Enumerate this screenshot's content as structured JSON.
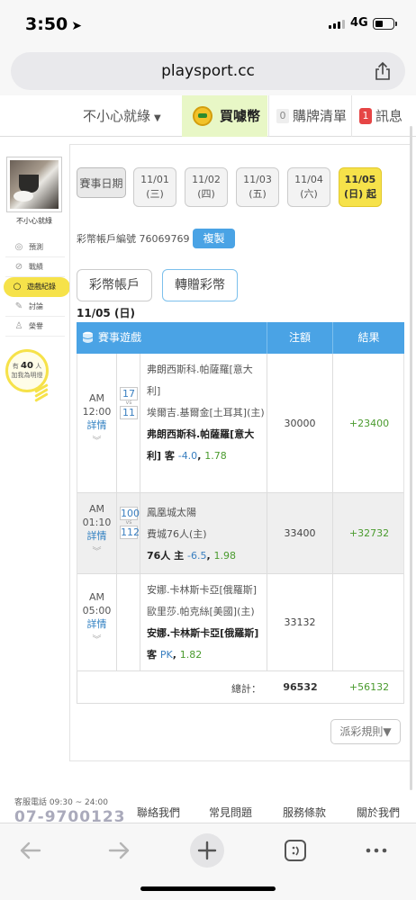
{
  "status": {
    "time": "3:50",
    "network": "4G"
  },
  "browser": {
    "url": "playsport.cc"
  },
  "topnav": {
    "user": "不小心就綠",
    "buy_label": "買噱幣",
    "cart_count": "0",
    "cart_label": "購牌清單",
    "msg_count": "1",
    "msg_label": "訊息"
  },
  "sidebar": {
    "name": "不小心就綠",
    "items": [
      {
        "label": "預測",
        "icon": "target-icon"
      },
      {
        "label": "戰績",
        "icon": "chart-icon"
      },
      {
        "label": "遊戲紀錄",
        "icon": "record-icon"
      },
      {
        "label": "討論",
        "icon": "discussion-icon"
      },
      {
        "label": "榮譽",
        "icon": "honor-icon"
      }
    ],
    "fans_prefix": "有",
    "fans_count": "40",
    "fans_unit": "人",
    "fans_suffix": "加我為明燈"
  },
  "dates": {
    "label": "賽事日期",
    "items": [
      {
        "date": "11/01",
        "day": "(三)"
      },
      {
        "date": "11/02",
        "day": "(四)"
      },
      {
        "date": "11/03",
        "day": "(五)"
      },
      {
        "date": "11/04",
        "day": "(六)"
      },
      {
        "date": "11/05",
        "day": "(日) 起"
      }
    ]
  },
  "account": {
    "label": "彩幣帳戶編號",
    "number": "76069769",
    "copy": "複製"
  },
  "tabs": {
    "coins": "彩幣帳戶",
    "transfer": "轉贈彩幣"
  },
  "day_title": "11/05 (日)",
  "table": {
    "headers": [
      "賽事遊戲",
      "注額",
      "結果"
    ],
    "rows": [
      {
        "ampm": "AM",
        "time": "12:00",
        "detail": "詳情",
        "away_score": "17",
        "home_score": "11",
        "vs": "vs",
        "away": "弗朗西斯科.帕薩羅[意大利]",
        "home": "埃爾吉.基爾金[土耳其](主)",
        "pick_team": "弗朗西斯科.帕薩羅[意大利]",
        "pick_side": "客",
        "handicap": "-4.0",
        "odds": "1.78",
        "stake": "30000",
        "result": "+23400"
      },
      {
        "ampm": "AM",
        "time": "01:10",
        "detail": "詳情",
        "away_score": "100",
        "home_score": "112",
        "vs": "vs",
        "away": "鳳凰城太陽",
        "home": "費城76人(主)",
        "pick_team": "76人",
        "pick_side": "主",
        "handicap": "-6.5",
        "odds": "1.98",
        "stake": "33400",
        "result": "+32732"
      },
      {
        "ampm": "AM",
        "time": "05:00",
        "detail": "詳情",
        "away": "安娜.卡林斯卡亞[俄羅斯]",
        "home": "歐里莎.帕克絲[美國](主)",
        "pick_team": "安娜.卡林斯卡亞[俄羅斯]",
        "pick_side": "客",
        "handicap": "PK",
        "odds": "1.82",
        "stake": "33132",
        "result": ""
      }
    ],
    "total_label": "總計：",
    "total_stake": "96532",
    "total_result": "+56132"
  },
  "rules_button": "派彩規則▼",
  "footer": {
    "hotline_label": "客服電話 09:30 ~ 24:00",
    "hotline_number": "07-9700123",
    "links": [
      "聯絡我們",
      "常見問題",
      "服務條款",
      "關於我們"
    ]
  },
  "colors": {
    "accent_blue": "#4aa3e5",
    "highlight_yellow": "#f6e24a",
    "win_green": "#4a9b2e",
    "buy_bg": "#e8f7c6",
    "badge_red": "#e64545"
  }
}
